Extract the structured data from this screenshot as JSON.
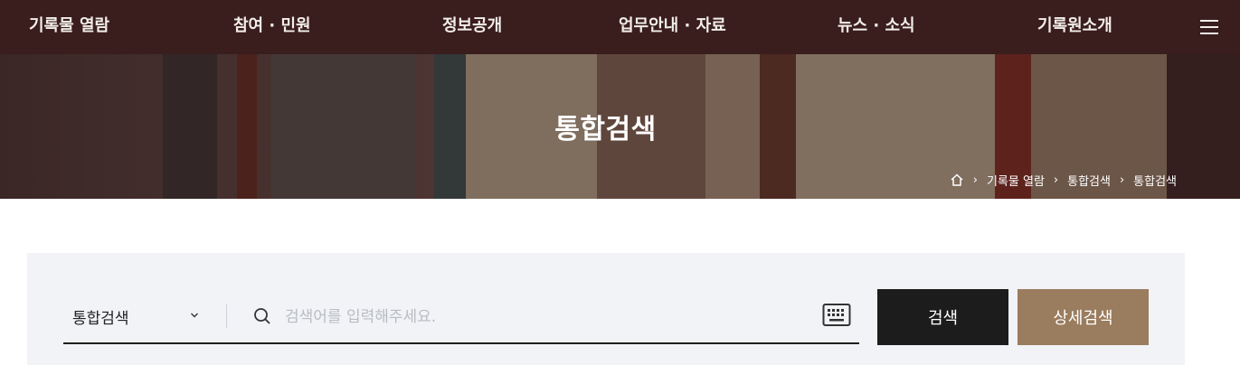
{
  "nav": {
    "items": [
      "기록물 열람",
      "참여 · 민원",
      "정보공개",
      "업무안내 · 자료",
      "뉴스 · 소식",
      "기록원소개"
    ],
    "menu_icon": "hamburger-menu-icon"
  },
  "hero": {
    "title": "통합검색",
    "breadcrumb": {
      "home_icon": "home-icon",
      "items": [
        "기록물 열람",
        "통합검색",
        "통합검색"
      ]
    }
  },
  "search": {
    "scope_selected": "통합검색",
    "placeholder": "검색어를 입력해주세요.",
    "value": "",
    "search_icon": "search-icon",
    "keyboard_icon": "keyboard-icon",
    "search_button": "검색",
    "advanced_button": "상세검색"
  },
  "colors": {
    "nav_bg": "#3a1d1d",
    "search_button_bg": "#1c1c1c",
    "advanced_button_bg": "#9a7c5e",
    "panel_bg": "#f1f3f7"
  }
}
